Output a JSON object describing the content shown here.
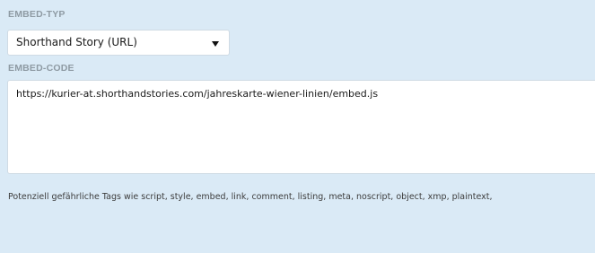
{
  "embed_type": {
    "label": "EMBED-TYP",
    "selected": "Shorthand Story (URL)"
  },
  "embed_code": {
    "label": "EMBED-CODE",
    "value": "https://kurier-at.shorthandstories.com/jahreskarte-wiener-linien/embed.js"
  },
  "hint": "Potenziell gefährliche Tags wie script, style, embed, link, comment, listing, meta, noscript, object, xmp, plaintext,",
  "colors": {
    "background": "#daeaf6",
    "label": "#8e9aa3",
    "field_border": "#cfdbe4"
  }
}
